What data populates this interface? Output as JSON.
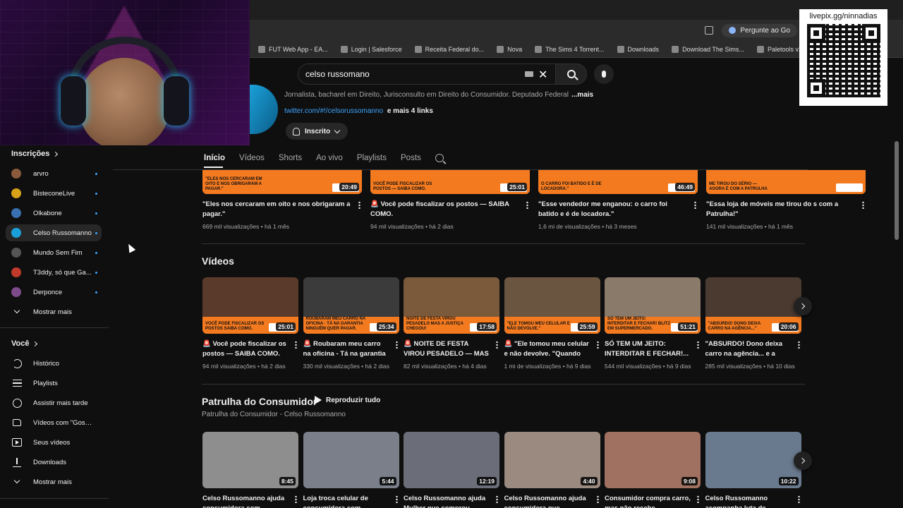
{
  "overlay": {
    "donation_label": "livepix.gg/ninnadias"
  },
  "browser": {
    "ai_button_label": "Pergunte ao Go",
    "bookmarks": [
      {
        "label": "FUT Web App - EA..."
      },
      {
        "label": "Login | Salesforce"
      },
      {
        "label": "Receita Federal do..."
      },
      {
        "label": "Nova"
      },
      {
        "label": "The Sims 4 Torrent..."
      },
      {
        "label": "Downloads"
      },
      {
        "label": "Download The Sims..."
      },
      {
        "label": "Paletools v25.1.11"
      }
    ]
  },
  "search": {
    "value": "celso russomano"
  },
  "channel": {
    "description": "Jornalista, bacharel em Direito, Jurisconsulto em Direito do Consumidor. Deputado Federal",
    "more_label": "...mais",
    "link": "twitter.com/#!/celsorussomanno",
    "more_links": "e mais 4 links",
    "subscribe_label": "Inscrito"
  },
  "tabs": [
    "Início",
    "Vídeos",
    "Shorts",
    "Ao vivo",
    "Playlists",
    "Posts"
  ],
  "sidebar": {
    "subscriptions_title": "Inscrições",
    "subscriptions": [
      {
        "label": "arvro",
        "color": "#8a5a3c"
      },
      {
        "label": "BisteconeLive",
        "color": "#d6a21a"
      },
      {
        "label": "Olkabone",
        "color": "#3a6fb0"
      },
      {
        "label": "Celso Russomanno",
        "color": "#1aa0d8"
      },
      {
        "label": "Mundo Sem Fim",
        "color": "#555555"
      },
      {
        "label": "T3ddy, só que Ga...",
        "color": "#c0392b"
      },
      {
        "label": "Derponce",
        "color": "#7d4b8a"
      }
    ],
    "show_more_1": "Mostrar mais",
    "you_title": "Você",
    "you_items": [
      {
        "label": "Histórico",
        "icon": "history-icon"
      },
      {
        "label": "Playlists",
        "icon": "playlists-icon"
      },
      {
        "label": "Assistir mais tarde",
        "icon": "watch-later-icon"
      },
      {
        "label": "Vídeos com \"Gostei\"",
        "icon": "like-icon"
      },
      {
        "label": "Seus vídeos",
        "icon": "your-videos-icon"
      },
      {
        "label": "Downloads",
        "icon": "download-icon"
      }
    ],
    "show_more_2": "Mostrar mais"
  },
  "shorts_row": [
    {
      "banner": "\"ELES NOS CERCARAM EM OITO E NOS OBRIGARAM A PAGAR.\"",
      "duration": "20:49",
      "title": "\"Eles nos cercaram em oito e nos obrigaram a pagar.\"",
      "meta": "669 mil visualizações • há 1 mês"
    },
    {
      "banner": "VOCÊ PODE FISCALIZAR OS POSTOS — SAIBA COMO.",
      "duration": "25:01",
      "title": "🚨 Você pode fiscalizar os postos — SAIBA COMO.",
      "meta": "94 mil visualizações • há 2 dias"
    },
    {
      "banner": "O CARRO FOI BATIDO E É DE LOCADORA.\"",
      "duration": "46:49",
      "title": "\"Esse vendedor me enganou: o carro foi batido e é de locadora.\"",
      "meta": "1,6 mi de visualizações • há 3 meses"
    },
    {
      "banner": "ME TIROU DO SÉRIO — AGORA É COM A PATRULHA",
      "duration": "",
      "title": "\"Essa loja de móveis me tirou do s com a Patrulha!\"",
      "meta": "141 mil visualizações • há 1 mês"
    }
  ],
  "videos_shelf": {
    "title": "Vídeos",
    "items": [
      {
        "banner": "VOCÊ PODE FISCALIZAR OS POSTOS SAIBA COMO.",
        "duration": "25:01",
        "title": "🚨 Você pode fiscalizar os postos — SAIBA COMO.",
        "meta": "94 mil visualizações • há 2 dias"
      },
      {
        "banner": "ROUBARAM MEU CARRO NA OFICINA - TÁ NA GARANTIA NINGUÉM QUER PAGAR.",
        "duration": "25:34",
        "title": "🚨 Roubaram meu carro na oficina - Tá na garantia -...",
        "meta": "330 mil visualizações • há 2 dias"
      },
      {
        "banner": "NOITE DE FESTA VIROU PESADELO MAS A JUSTIÇA CHEGOU!",
        "duration": "17:58",
        "title": "🚨 NOITE DE FESTA VIROU PESADELO — MAS A...",
        "meta": "82 mil visualizações • há 4 dias"
      },
      {
        "banner": "\"ELE TOMOU MEU CELULAR E NÃO DEVOLVE.\"",
        "duration": "25:59",
        "title": "🚨 \"Ele tomou meu celular e não devolve. \"Quando a...",
        "meta": "1 mi de visualizações • há 9 dias"
      },
      {
        "banner": "SÓ TEM UM JEITO: INTERDITAR E FECHAR! BLITZ EM SUPERMERCADO.",
        "duration": "51:21",
        "title": "SÓ TEM UM JEITO: INTERDITAR E FECHAR!...",
        "meta": "544 mil visualizações • há 9 dias"
      },
      {
        "banner": "\"ABSURDO! DONO DEIXA CARRO NA AGÊNCIA...\"",
        "duration": "20:06",
        "title": "\"ABSURDO! Dono deixa carro na agência... e a dívida...",
        "meta": "285 mil visualizações • há 10 dias"
      }
    ]
  },
  "playlist_shelf": {
    "title": "Patrulha do Consumidor",
    "play_all": "Reproduzir tudo",
    "subtitle": "Patrulha do Consumidor - Celso Russomanno",
    "items": [
      {
        "duration": "8:45",
        "title": "Celso Russomanno ajuda consumidora com problema...",
        "color": "#8e8e8e"
      },
      {
        "duration": "5:44",
        "title": "Loja troca celular de consumidora com problemas...",
        "color": "#7a7f8a"
      },
      {
        "duration": "12:19",
        "title": "Celso Russomanno ajuda Mulher que comprou móveis...",
        "color": "#6b6e78"
      },
      {
        "duration": "4:40",
        "title": "Celso Russomanno ajuda consumidora que comprou...",
        "color": "#9a8a80"
      },
      {
        "duration": "9:08",
        "title": "Consumidor compra carro, mas não recebe...",
        "color": "#a07060"
      },
      {
        "duration": "10:22",
        "title": "Celso Russomanno acompanha luta de...",
        "color": "#6a7a8e"
      }
    ]
  }
}
